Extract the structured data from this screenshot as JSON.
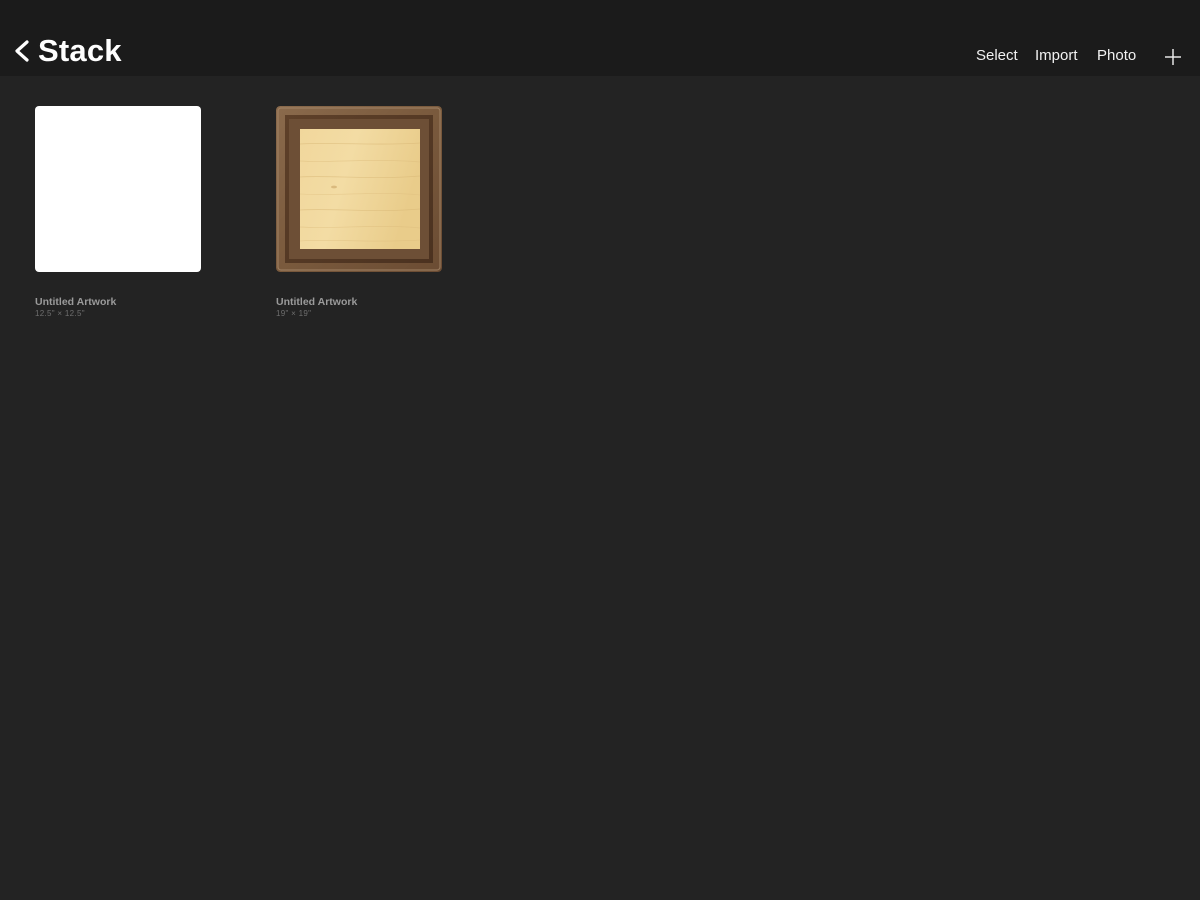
{
  "navbar": {
    "title": "Stack",
    "back_icon": "chevron-left-icon",
    "actions": {
      "select_label": "Select",
      "import_label": "Import",
      "photo_label": "Photo",
      "add_icon": "plus-icon"
    }
  },
  "gallery": {
    "artworks": [
      {
        "title": "Untitled Artwork",
        "size": "12.5\" × 12.5\"",
        "thumbnail": "blank-white-canvas"
      },
      {
        "title": "Untitled Artwork",
        "size": "19\" × 19\"",
        "thumbnail": "wooden-frame-canvas"
      }
    ]
  },
  "colors": {
    "background": "#232323",
    "navbar": "#1b1b1b",
    "text_primary": "#ffffff",
    "text_secondary": "#9a9a9a",
    "text_tertiary": "#6e6e6e"
  }
}
